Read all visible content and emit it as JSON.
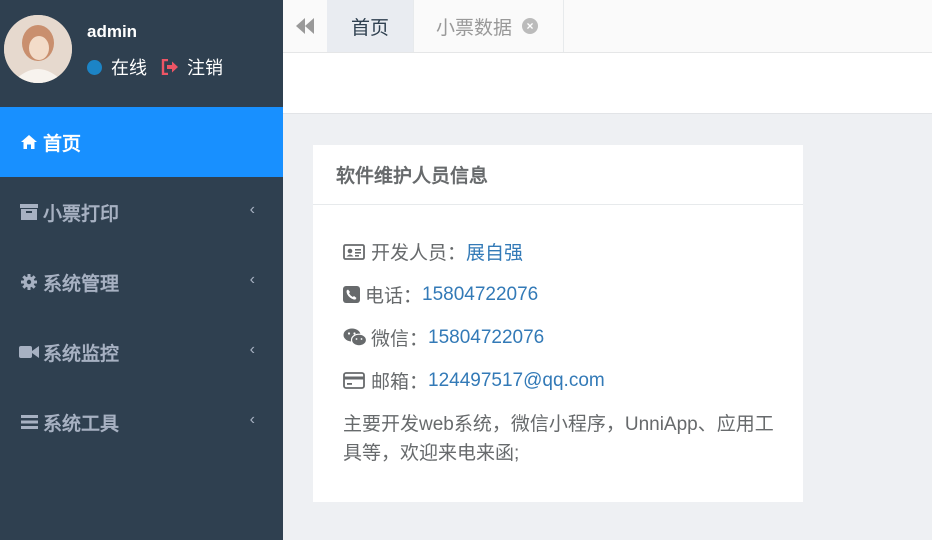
{
  "sidebar": {
    "user": {
      "name": "admin",
      "status": "在线",
      "logout": "注销"
    },
    "items": [
      {
        "label": "首页",
        "icon": "home-icon"
      },
      {
        "label": "小票打印",
        "icon": "archive-icon"
      },
      {
        "label": "系统管理",
        "icon": "gear-icon"
      },
      {
        "label": "系统监控",
        "icon": "video-camera-icon"
      },
      {
        "label": "系统工具",
        "icon": "bars-icon"
      }
    ]
  },
  "tabs": [
    {
      "label": "首页"
    },
    {
      "label": "小票数据"
    }
  ],
  "card": {
    "title": "软件维护人员信息",
    "rows": [
      {
        "label": "开发人员：",
        "value": "展自强",
        "icon": "id-card-icon"
      },
      {
        "label": "电话：",
        "value": "15804722076",
        "icon": "phone-icon"
      },
      {
        "label": "微信：",
        "value": "15804722076",
        "icon": "wechat-icon"
      },
      {
        "label": "邮箱：",
        "value": "124497517@qq.com",
        "icon": "credit-card-icon"
      }
    ],
    "description": "主要开发web系统，微信小程序，UnniApp、应用工具等，欢迎来电来函;"
  },
  "colors": {
    "sidebar_bg": "#2f4050",
    "active": "#1890ff",
    "link": "#337ab7"
  }
}
